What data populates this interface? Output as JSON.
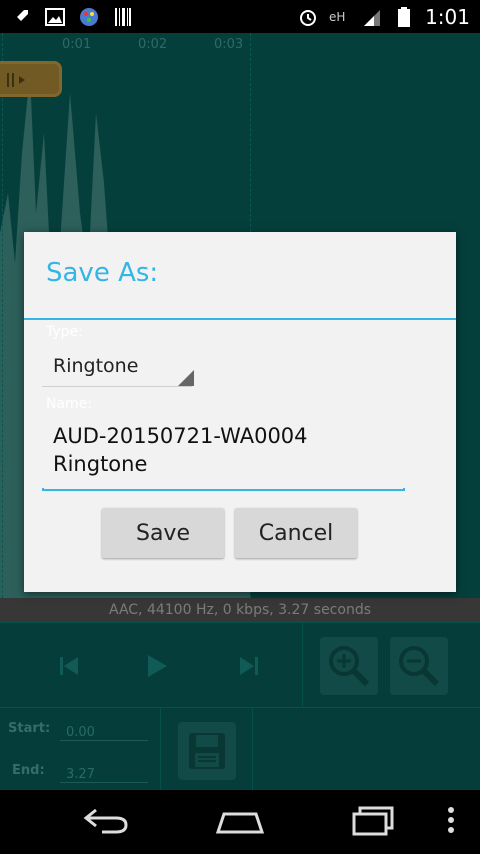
{
  "status_bar": {
    "time": "1:01",
    "left_icons": [
      "rocket-icon",
      "image-icon",
      "paint-icon",
      "barcode-icon"
    ],
    "right_icons": [
      "alarm-icon",
      "network-icon",
      "signal-icon",
      "battery-icon"
    ]
  },
  "waveform": {
    "ticks": [
      "0:01",
      "0:02",
      "0:03"
    ]
  },
  "info_line": "AAC, 44100 Hz, 0 kbps, 3.27 seconds",
  "controls": {
    "prev_icon": "skip-previous-icon",
    "play_icon": "play-icon",
    "next_icon": "skip-next-icon",
    "zoom_in_icon": "zoom-in-icon",
    "zoom_out_icon": "zoom-out-icon"
  },
  "editor": {
    "start_label": "Start:",
    "start_value": "0.00",
    "end_label": "End:",
    "end_value": "3.27"
  },
  "dialog": {
    "title": "Save As:",
    "type_label": "Type:",
    "type_value": "Ringtone",
    "name_label": "Name:",
    "name_value_line1": "AUD-20150721-WA0004",
    "name_value_line2": "Ringtone",
    "save_label": "Save",
    "cancel_label": "Cancel"
  },
  "nav": [
    "back-icon",
    "home-icon",
    "recents-icon",
    "menu-icon"
  ],
  "colors": {
    "accent": "#33b5e5",
    "background": "#08615c"
  }
}
